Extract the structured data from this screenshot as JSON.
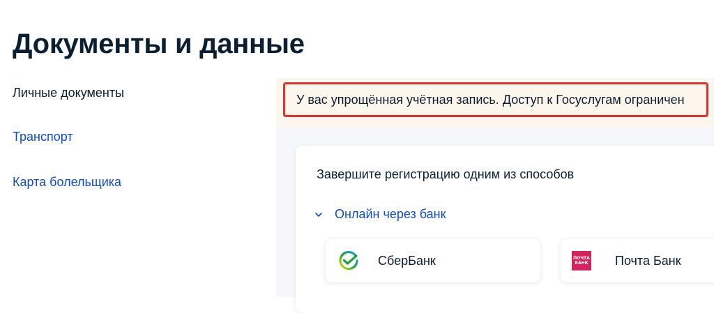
{
  "page": {
    "title": "Документы и данные"
  },
  "sidebar": {
    "items": [
      {
        "label": "Личные документы",
        "active": true
      },
      {
        "label": "Транспорт",
        "active": false
      },
      {
        "label": "Карта болельщика",
        "active": false
      }
    ]
  },
  "alert": {
    "text": "У вас упрощённая учётная запись. Доступ к Госуслугам ограничен"
  },
  "registration": {
    "title": "Завершите регистрацию одним из способов",
    "method": {
      "label": "Онлайн через банк",
      "icon": "chevron-down-icon",
      "expanded": true
    },
    "banks": [
      {
        "label": "СберБанк",
        "icon": "sberbank-logo"
      },
      {
        "label": "Почта Банк",
        "icon": "pochta-bank-logo",
        "logo_text": [
          "ПОЧТА",
          "БАНК"
        ]
      }
    ]
  },
  "colors": {
    "text": "#0b1f33",
    "link": "#0d4cd3",
    "alert_border": "#e0312c",
    "alert_background": "#fdf6ec",
    "sber_green": "#21a038",
    "pochta_red": "#d6235b"
  }
}
